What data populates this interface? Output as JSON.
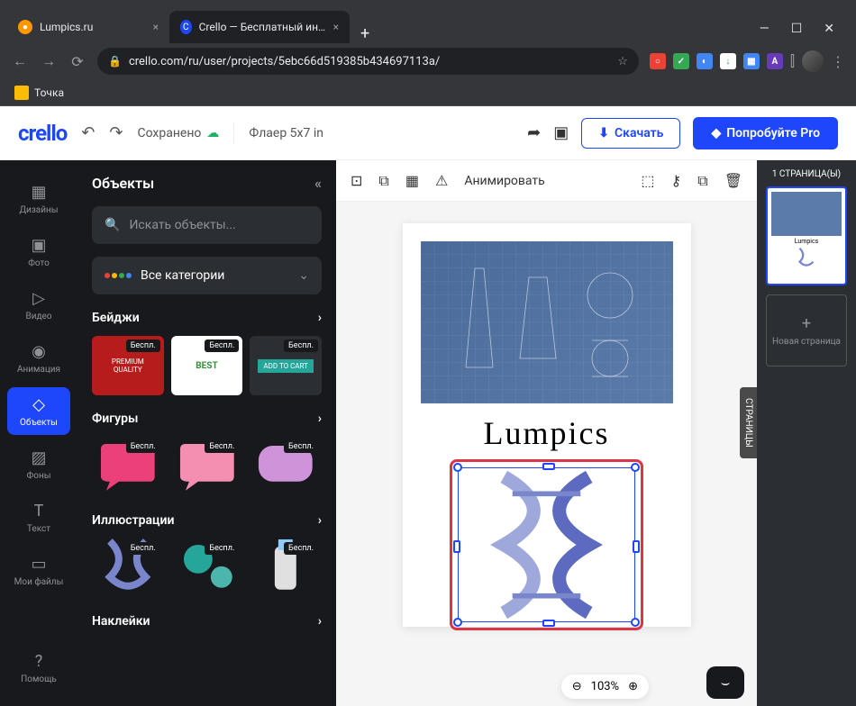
{
  "browser": {
    "tabs": [
      {
        "title": "Lumpics.ru",
        "favicon_color": "#ff9800"
      },
      {
        "title": "Crello — Бесплатный инструмен",
        "favicon_color": "#1e47fb"
      }
    ],
    "url": "crello.com/ru/user/projects/5ebc66d519385b434697113a/",
    "bookmark": "Точка"
  },
  "app_header": {
    "logo": "crello",
    "saved_label": "Сохранено",
    "project_name": "Флаер 5x7  in",
    "download_label": "Скачать",
    "pro_label": "Попробуйте Pro"
  },
  "rail": {
    "items": [
      {
        "label": "Дизайны",
        "icon": "grid"
      },
      {
        "label": "Фото",
        "icon": "image"
      },
      {
        "label": "Видео",
        "icon": "play"
      },
      {
        "label": "Анимация",
        "icon": "disc"
      },
      {
        "label": "Объекты",
        "icon": "shapes",
        "active": true
      },
      {
        "label": "Фоны",
        "icon": "pattern"
      },
      {
        "label": "Текст",
        "icon": "text"
      },
      {
        "label": "Мои файлы",
        "icon": "folder"
      }
    ],
    "help_label": "Помощь"
  },
  "panel": {
    "title": "Объекты",
    "search_placeholder": "Искать объекты...",
    "categories_label": "Все категории",
    "free_tag": "Беспл.",
    "sections": [
      {
        "title": "Бейджи"
      },
      {
        "title": "Фигуры"
      },
      {
        "title": "Иллюстрации"
      },
      {
        "title": "Наклейки"
      }
    ]
  },
  "toolbar": {
    "animate_label": "Анимировать"
  },
  "canvas": {
    "title_text": "Lumpics"
  },
  "zoom": {
    "value": "103%"
  },
  "pages": {
    "header": "1 СТРАНИЦА(Ы)",
    "new_page_label": "Новая страница",
    "tab_label": "СТРАНИЦЫ"
  }
}
